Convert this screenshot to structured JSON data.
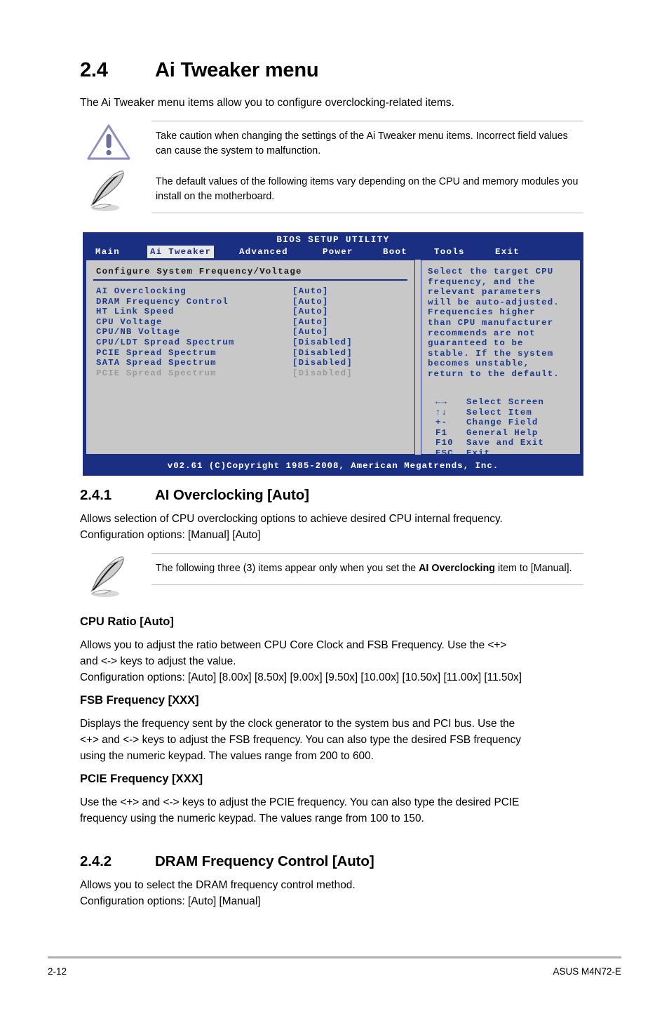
{
  "heading": {
    "number": "2.4",
    "title": "Ai Tweaker menu"
  },
  "intro": "The Ai Tweaker menu items allow you to configure overclocking-related items.",
  "caution_note": {
    "icon": "caution-triangle-icon",
    "text": "Take caution when changing the settings of the Ai Tweaker menu items. Incorrect field values can cause the system to malfunction."
  },
  "default_note": {
    "icon": "pencil-note-icon",
    "text": "The default values of the following items vary depending on the CPU and memory modules you install on the motherboard."
  },
  "bios": {
    "title": "BIOS SETUP UTILITY",
    "tabs": [
      {
        "label": "Main",
        "active": false
      },
      {
        "label": "Ai Tweaker",
        "active": true
      },
      {
        "label": "Advanced",
        "active": false
      },
      {
        "label": "Power",
        "active": false
      },
      {
        "label": "Boot",
        "active": false
      },
      {
        "label": "Tools",
        "active": false
      },
      {
        "label": "Exit",
        "active": false
      }
    ],
    "panel_header": "Configure System Frequency/Voltage",
    "items": [
      {
        "label": "AI Overclocking",
        "value": "[Auto]",
        "dimmed": false
      },
      {
        "label": "DRAM Frequency Control",
        "value": "[Auto]",
        "dimmed": false
      },
      {
        "label": "HT Link Speed",
        "value": "[Auto]",
        "dimmed": false
      },
      {
        "label": "CPU Voltage",
        "value": "[Auto]",
        "dimmed": false
      },
      {
        "label": "CPU/NB Voltage",
        "value": "[Auto]",
        "dimmed": false
      },
      {
        "label": "CPU/LDT Spread Spectrum",
        "value": "[Disabled]",
        "dimmed": false
      },
      {
        "label": "PCIE Spread Spectrum",
        "value": "[Disabled]",
        "dimmed": false
      },
      {
        "label": "SATA Spread Spectrum",
        "value": "[Disabled]",
        "dimmed": false
      },
      {
        "label": "PCIE Spread Spectrum",
        "value": "[Disabled]",
        "dimmed": true
      }
    ],
    "help_lines": [
      "Select the target CPU",
      "frequency, and the",
      "relevant parameters",
      "will be auto-adjusted.",
      "Frequencies higher",
      "than CPU manufacturer",
      "recommends are not",
      "guaranteed to be",
      "stable. If the system",
      "becomes unstable,",
      "return to the default."
    ],
    "legend": [
      {
        "key": "←→",
        "desc": "Select Screen"
      },
      {
        "key": "↑↓",
        "desc": "Select Item"
      },
      {
        "key": "+-",
        "desc": "Change Field"
      },
      {
        "key": "F1",
        "desc": "General Help"
      },
      {
        "key": "F10",
        "desc": "Save and Exit"
      },
      {
        "key": "ESC",
        "desc": "Exit"
      }
    ],
    "footer": "v02.61 (C)Copyright 1985-2008, American Megatrends, Inc.",
    "colors": {
      "background": "#1b2f82",
      "panel": "#c8c8c8",
      "item_text": "#1b3a8c",
      "dim_text": "#9a9a9a",
      "active_tab_bg": "#e8e8e8"
    }
  },
  "section_241": {
    "number": "2.4.1",
    "title": "AI Overclocking [Auto]",
    "body_line1": "Allows selection of CPU overclocking options to achieve desired CPU internal frequency.",
    "body_line2": "Configuration options: [Manual] [Auto]"
  },
  "manual_note": {
    "icon": "pencil-note-icon",
    "text_before": "The following three (3) items appear only when you set the ",
    "text_bold": "AI Overclocking",
    "text_after": " item to [Manual]."
  },
  "cpu_ratio": {
    "title": "CPU Ratio [Auto]",
    "body_line1": "Allows you to adjust the ratio between CPU Core Clock and FSB Frequency. Use the <+>",
    "body_line2": "and <-> keys to adjust the value.",
    "body_line3": "Configuration options: [Auto] [8.00x] [8.50x] [9.00x] [9.50x] [10.00x] [10.50x] [11.00x] [11.50x]"
  },
  "fsb_frequency": {
    "title": "FSB Frequency [XXX]",
    "body_line1": "Displays the frequency sent by the clock generator to the system bus and PCI bus. Use the",
    "body_line2": "<+> and <-> keys to adjust the FSB frequency. You can also type the desired FSB frequency",
    "body_line3": "using the numeric keypad. The values range from 200 to 600."
  },
  "pcie_frequency": {
    "title": "PCIE Frequency [XXX]",
    "body_line1": "Use the <+> and <-> keys to adjust the PCIE frequency. You can also type the desired PCIE",
    "body_line2": "frequency using the numeric keypad. The values range from 100 to 150."
  },
  "section_242": {
    "number": "2.4.2",
    "title": "DRAM Frequency Control [Auto]",
    "body_line1": "Allows you to select the DRAM frequency control method.",
    "body_line2": "Configuration options: [Auto] [Manual]"
  },
  "footer": {
    "page_number": "2-12",
    "product": "ASUS M4N72-E"
  }
}
